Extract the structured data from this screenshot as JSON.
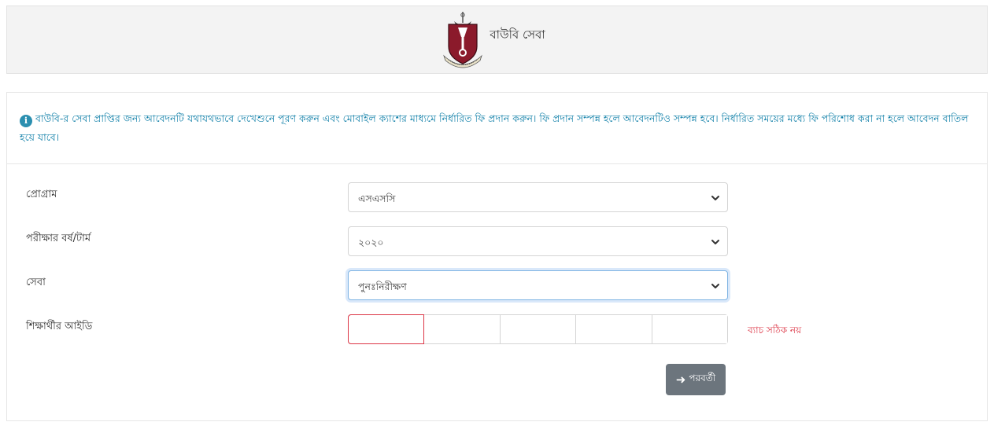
{
  "header": {
    "title": "বাউবি সেবা",
    "logo_icon": "university-crest-logo"
  },
  "notice": {
    "icon": "info-icon",
    "text": "বাউবি-র সেবা প্রাপ্তির জন্য আবেদনটি যথাযথভাবে দেখেশুনে পূরণ করুন এবং মোবাইল ক্যাশের মাধ্যমে নির্ধারিত ফি প্রদান করুন। ফি প্রদান সম্পন্ন হলে আবেদনটিও সম্পন্ন হবে। নির্ধারিত সময়ের মধ্যে ফি পরিশোধ করা না হলে আবেদন বাতিল হয়ে যাবে।",
    "color": "#0f7fa8"
  },
  "form": {
    "program": {
      "label": "প্রোগ্রাম",
      "selected": "এসএসসি"
    },
    "exam_year": {
      "label": "পরীক্ষার বর্ষ/টার্ম",
      "selected": "২০২০"
    },
    "service": {
      "label": "সেবা",
      "selected": "পুনঃনিরীক্ষণ"
    },
    "student_id": {
      "label": "শিক্ষার্থীর আইডি",
      "error": "ব্যাচ সঠিক নয়",
      "error_color": "#dc3545"
    },
    "next_button": {
      "label": "পরবর্তী",
      "icon": "arrow-right-icon"
    }
  }
}
